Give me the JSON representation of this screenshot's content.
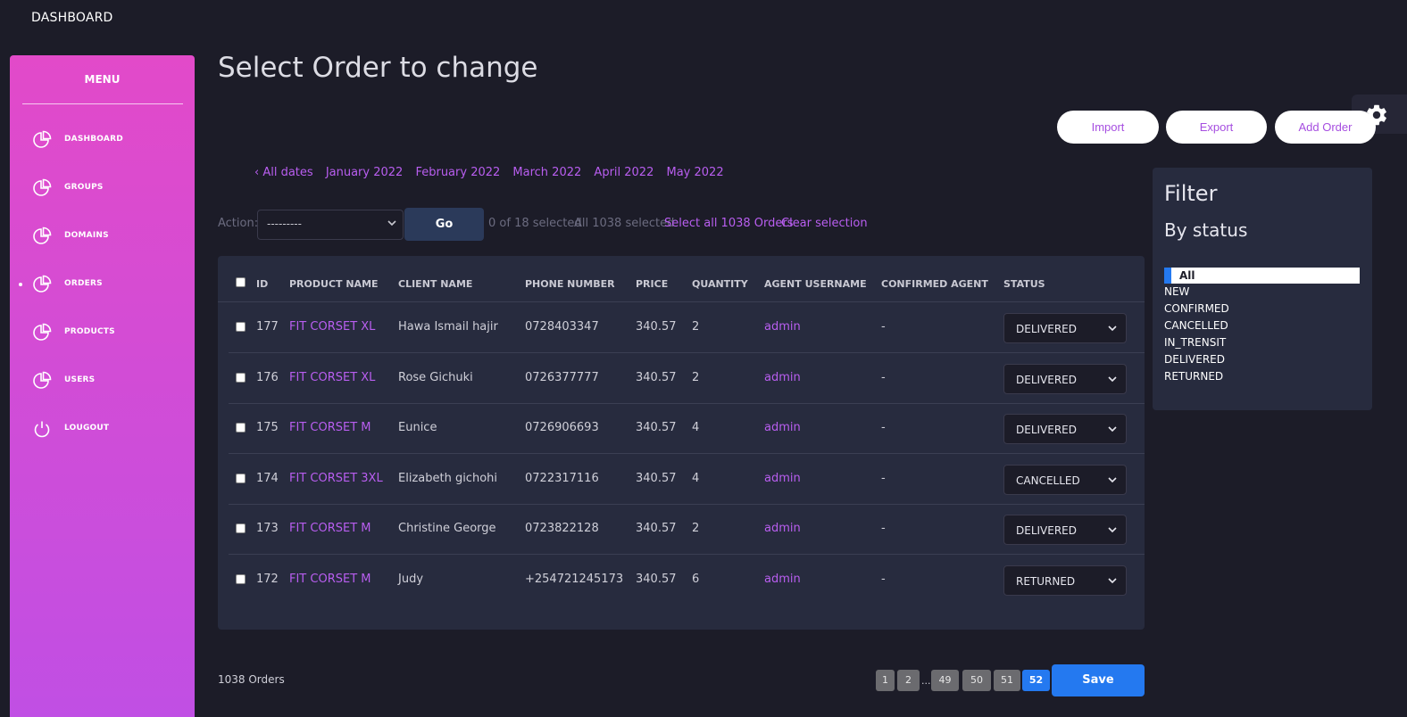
{
  "topbar": {
    "brand": "DASHBOARD"
  },
  "sidebar": {
    "title": "MENU",
    "items": [
      {
        "label": "DASHBOARD",
        "icon": "pie-chart-icon",
        "active": false
      },
      {
        "label": "GROUPS",
        "icon": "pie-chart-icon",
        "active": false
      },
      {
        "label": "DOMAINS",
        "icon": "pie-chart-icon",
        "active": false
      },
      {
        "label": "ORDERS",
        "icon": "pie-chart-icon",
        "active": true
      },
      {
        "label": "PRODUCTS",
        "icon": "pie-chart-icon",
        "active": false
      },
      {
        "label": "USERS",
        "icon": "pie-chart-icon",
        "active": false
      },
      {
        "label": "LOUGOUT",
        "icon": "power-icon",
        "active": false
      }
    ]
  },
  "page": {
    "title": "Select Order to change"
  },
  "buttons": {
    "import": "Import",
    "export": "Export",
    "add": "Add Order"
  },
  "dates": {
    "all": "‹ All dates",
    "months": [
      "January 2022",
      "February 2022",
      "March 2022",
      "April 2022",
      "May 2022"
    ]
  },
  "actions": {
    "label": "Action:",
    "select_value": "---------",
    "go": "Go",
    "count": "0 of 18 selected",
    "all_selected": "All 1038 selected",
    "select_all": "Select all 1038 Orders",
    "clear": "Clear selection"
  },
  "table": {
    "headers": [
      "ID",
      "PRODUCT NAME",
      "CLIENT NAME",
      "PHONE NUMBER",
      "PRICE",
      "QUANTITY",
      "AGENT USERNAME",
      "CONFIRMED AGENT",
      "STATUS"
    ],
    "rows": [
      {
        "id": "177",
        "product": "FIT CORSET XL",
        "client": "Hawa Ismail hajir",
        "phone": "0728403347",
        "price": "340.57",
        "qty": "2",
        "agent": "admin",
        "confirmed": "-",
        "status": "DELIVERED"
      },
      {
        "id": "176",
        "product": "FIT CORSET XL",
        "client": "Rose Gichuki",
        "phone": "0726377777",
        "price": "340.57",
        "qty": "2",
        "agent": "admin",
        "confirmed": "-",
        "status": "DELIVERED"
      },
      {
        "id": "175",
        "product": "FIT CORSET M",
        "client": "Eunice",
        "phone": "0726906693",
        "price": "340.57",
        "qty": "4",
        "agent": "admin",
        "confirmed": "-",
        "status": "DELIVERED"
      },
      {
        "id": "174",
        "product": "FIT CORSET 3XL",
        "client": "Elizabeth gichohi",
        "phone": "0722317116",
        "price": "340.57",
        "qty": "4",
        "agent": "admin",
        "confirmed": "-",
        "status": "CANCELLED"
      },
      {
        "id": "173",
        "product": "FIT CORSET M",
        "client": "Christine George",
        "phone": "0723822128",
        "price": "340.57",
        "qty": "2",
        "agent": "admin",
        "confirmed": "-",
        "status": "DELIVERED"
      },
      {
        "id": "172",
        "product": "FIT CORSET M",
        "client": "Judy",
        "phone": "+254721245173",
        "price": "340.57",
        "qty": "6",
        "agent": "admin",
        "confirmed": "-",
        "status": "RETURNED"
      }
    ]
  },
  "footer": {
    "count": "1038 Orders",
    "pages": [
      "1",
      "2",
      "49",
      "50",
      "51",
      "52"
    ],
    "dots": "...",
    "current_page": "52",
    "save": "Save"
  },
  "filter": {
    "title": "Filter",
    "subtitle": "By status",
    "options": [
      "All",
      "NEW",
      "CONFIRMED",
      "CANCELLED",
      "IN_TRENSIT",
      "DELIVERED",
      "RETURNED"
    ]
  },
  "colors": {
    "accent": "#b95ef0",
    "primary": "#2479f0",
    "sidebar_top": "#e24ac9",
    "sidebar_bottom": "#c04fe4",
    "background": "#1c1c28",
    "card": "#272b3e"
  }
}
